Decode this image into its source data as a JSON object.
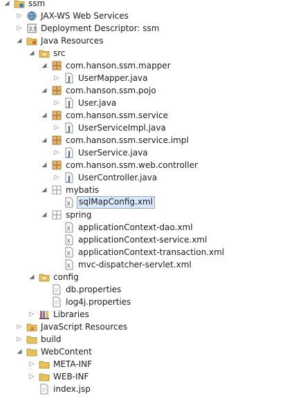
{
  "tree": [
    {
      "label": "ssm",
      "icon": "project-icon",
      "expanded": true,
      "depth": 0,
      "kind": "project"
    },
    {
      "label": "JAX-WS Web Services",
      "icon": "jaxws-icon",
      "expanded": false,
      "depth": 1,
      "kind": "jaxws"
    },
    {
      "label": "Deployment Descriptor: ssm",
      "icon": "deployment-descriptor-icon",
      "expanded": false,
      "depth": 1,
      "kind": "dd"
    },
    {
      "label": "Java Resources",
      "icon": "java-resources-icon",
      "expanded": true,
      "depth": 1,
      "kind": "jres"
    },
    {
      "label": "src",
      "icon": "source-folder-icon",
      "expanded": true,
      "depth": 2,
      "kind": "srcfolder"
    },
    {
      "label": "com.hanson.ssm.mapper",
      "icon": "package-icon",
      "expanded": true,
      "depth": 3,
      "kind": "package"
    },
    {
      "label": "UserMapper.java",
      "icon": "java-file-icon",
      "expanded": false,
      "depth": 4,
      "kind": "java"
    },
    {
      "label": "com.hanson.ssm.pojo",
      "icon": "package-icon",
      "expanded": true,
      "depth": 3,
      "kind": "package"
    },
    {
      "label": "User.java",
      "icon": "java-file-icon",
      "expanded": false,
      "depth": 4,
      "kind": "java"
    },
    {
      "label": "com.hanson.ssm.service",
      "icon": "package-icon",
      "expanded": true,
      "depth": 3,
      "kind": "package"
    },
    {
      "label": "UserServiceImpl.java",
      "icon": "java-file-icon",
      "expanded": false,
      "depth": 4,
      "kind": "java"
    },
    {
      "label": "com.hanson.ssm.service.impl",
      "icon": "package-icon",
      "expanded": true,
      "depth": 3,
      "kind": "package"
    },
    {
      "label": "UserService.java",
      "icon": "java-file-icon",
      "expanded": false,
      "depth": 4,
      "kind": "java"
    },
    {
      "label": "com.hanson.ssm.web.controller",
      "icon": "package-icon",
      "expanded": true,
      "depth": 3,
      "kind": "package"
    },
    {
      "label": "UserController.java",
      "icon": "java-file-icon",
      "expanded": false,
      "depth": 4,
      "kind": "java"
    },
    {
      "label": "mybatis",
      "icon": "empty-package-icon",
      "expanded": true,
      "depth": 3,
      "kind": "emptypkg"
    },
    {
      "label": "sqlMapConfig.xml",
      "icon": "xml-file-icon",
      "expanded": null,
      "depth": 4,
      "kind": "xml",
      "selected": true
    },
    {
      "label": "spring",
      "icon": "empty-package-icon",
      "expanded": true,
      "depth": 3,
      "kind": "emptypkg"
    },
    {
      "label": "applicationContext-dao.xml",
      "icon": "xml-file-icon",
      "expanded": null,
      "depth": 4,
      "kind": "xml"
    },
    {
      "label": "applicationContext-service.xml",
      "icon": "xml-file-icon",
      "expanded": null,
      "depth": 4,
      "kind": "xml"
    },
    {
      "label": "applicationContext-transaction.xml",
      "icon": "xml-file-icon",
      "expanded": null,
      "depth": 4,
      "kind": "xml"
    },
    {
      "label": "mvc-dispatcher-servlet.xml",
      "icon": "xml-file-icon",
      "expanded": null,
      "depth": 4,
      "kind": "xml"
    },
    {
      "label": "config",
      "icon": "source-folder-icon",
      "expanded": true,
      "depth": 2,
      "kind": "srcfolder"
    },
    {
      "label": "db.properties",
      "icon": "properties-file-icon",
      "expanded": null,
      "depth": 3,
      "kind": "file"
    },
    {
      "label": "log4j.properties",
      "icon": "properties-file-icon",
      "expanded": null,
      "depth": 3,
      "kind": "file"
    },
    {
      "label": "Libraries",
      "icon": "libraries-icon",
      "expanded": false,
      "depth": 2,
      "kind": "libs"
    },
    {
      "label": "JavaScript Resources",
      "icon": "javascript-resources-icon",
      "expanded": false,
      "depth": 1,
      "kind": "jsres"
    },
    {
      "label": "build",
      "icon": "folder-icon",
      "expanded": false,
      "depth": 1,
      "kind": "folder"
    },
    {
      "label": "WebContent",
      "icon": "folder-icon",
      "expanded": true,
      "depth": 1,
      "kind": "folder"
    },
    {
      "label": "META-INF",
      "icon": "folder-icon",
      "expanded": false,
      "depth": 2,
      "kind": "folder"
    },
    {
      "label": "WEB-INF",
      "icon": "folder-icon",
      "expanded": false,
      "depth": 2,
      "kind": "folder"
    },
    {
      "label": "index.jsp",
      "icon": "jsp-file-icon",
      "expanded": null,
      "depth": 2,
      "kind": "file"
    }
  ],
  "colors": {
    "selection_bg": "#d9e8fb",
    "folder": "#e8c15a",
    "package": "#b0793a",
    "java_file_letter": "#2f5aa8"
  }
}
